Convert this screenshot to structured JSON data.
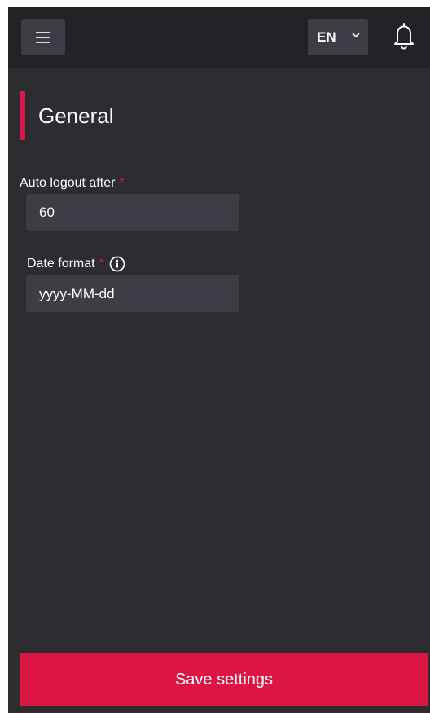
{
  "header": {
    "menu_icon": "hamburger-menu-icon",
    "language": "EN",
    "language_icon": "chevron-down-icon",
    "notification_icon": "bell-icon"
  },
  "section": {
    "title": "General",
    "accent_color": "#d8174a"
  },
  "fields": {
    "auto_logout": {
      "label": "Auto logout after",
      "required_marker": "*",
      "value": "60"
    },
    "date_format": {
      "label": "Date format",
      "required_marker": "*",
      "info_icon": "info-icon",
      "value": "yyyy-MM-dd"
    }
  },
  "actions": {
    "save_label": "Save settings",
    "save_color": "#dd1545"
  }
}
